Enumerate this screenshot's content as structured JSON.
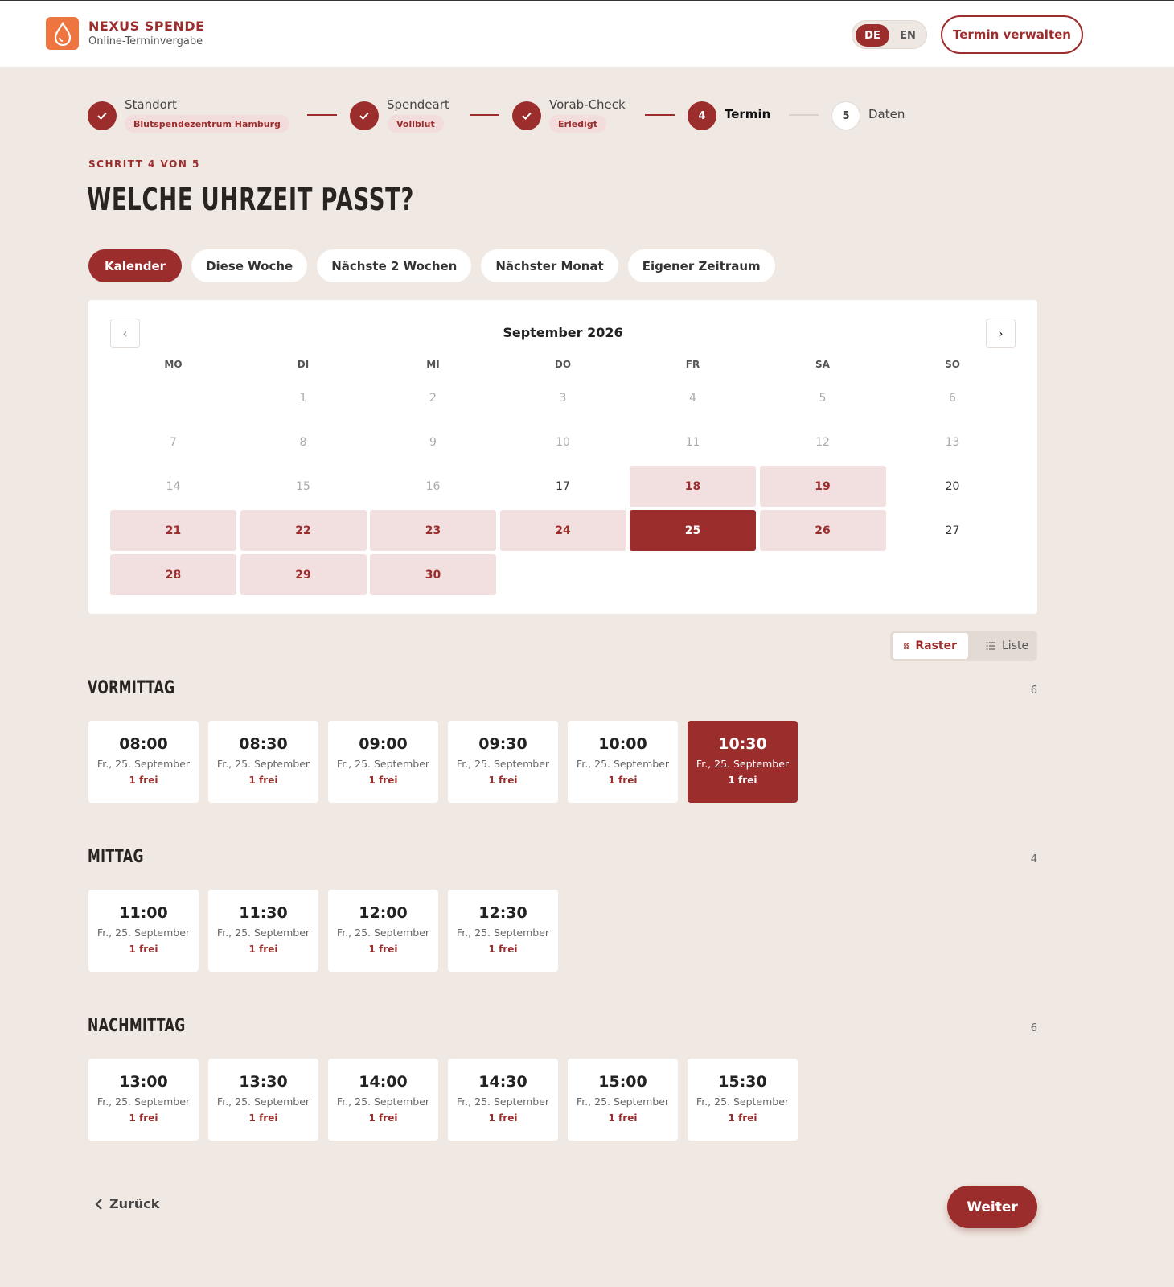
{
  "header": {
    "brand_name": "NEXUS SPENDE",
    "brand_sub": "Online-Terminvergabe",
    "lang_de": "DE",
    "lang_en": "EN",
    "active_lang": "DE",
    "manage_label": "Termin verwalten",
    "logo_icon": "blood-drop-icon"
  },
  "steps": [
    {
      "label": "Standort",
      "chip": "Blutspendezentrum Hamburg",
      "status": "done"
    },
    {
      "label": "Spendeart",
      "chip": "Vollblut",
      "status": "done"
    },
    {
      "label": "Vorab-Check",
      "chip": "Erledigt",
      "status": "done"
    },
    {
      "label": "Termin",
      "number": "4",
      "status": "current"
    },
    {
      "label": "Daten",
      "number": "5",
      "status": "todo"
    }
  ],
  "step_of": "SCHRITT 4 VON 5",
  "title": "WELCHE UHRZEIT PASST?",
  "range_tabs": [
    "Kalender",
    "Diese Woche",
    "Nächste 2 Wochen",
    "Nächster Monat",
    "Eigener Zeitraum"
  ],
  "active_range_tab": "Kalender",
  "calendar": {
    "month_label": "September 2026",
    "weekdays": [
      "MO",
      "DI",
      "MI",
      "DO",
      "FR",
      "SA",
      "SO"
    ],
    "days": [
      {
        "d": "",
        "s": "empty"
      },
      {
        "d": "1",
        "s": "past"
      },
      {
        "d": "2",
        "s": "past"
      },
      {
        "d": "3",
        "s": "past"
      },
      {
        "d": "4",
        "s": "past"
      },
      {
        "d": "5",
        "s": "past"
      },
      {
        "d": "6",
        "s": "past"
      },
      {
        "d": "7",
        "s": "past"
      },
      {
        "d": "8",
        "s": "past"
      },
      {
        "d": "9",
        "s": "past"
      },
      {
        "d": "10",
        "s": "past"
      },
      {
        "d": "11",
        "s": "past"
      },
      {
        "d": "12",
        "s": "past"
      },
      {
        "d": "13",
        "s": "past"
      },
      {
        "d": "14",
        "s": "past"
      },
      {
        "d": "15",
        "s": "past"
      },
      {
        "d": "16",
        "s": "past"
      },
      {
        "d": "17",
        "s": "open"
      },
      {
        "d": "18",
        "s": "avail"
      },
      {
        "d": "19",
        "s": "avail"
      },
      {
        "d": "20",
        "s": "open"
      },
      {
        "d": "21",
        "s": "avail"
      },
      {
        "d": "22",
        "s": "avail"
      },
      {
        "d": "23",
        "s": "avail"
      },
      {
        "d": "24",
        "s": "avail"
      },
      {
        "d": "25",
        "s": "selected"
      },
      {
        "d": "26",
        "s": "avail"
      },
      {
        "d": "27",
        "s": "open"
      },
      {
        "d": "28",
        "s": "avail"
      },
      {
        "d": "29",
        "s": "avail"
      },
      {
        "d": "30",
        "s": "avail"
      }
    ]
  },
  "view_toggle": {
    "grid_label": "Raster",
    "list_label": "Liste",
    "active": "Raster"
  },
  "sections": [
    {
      "title": "VORMITTAG",
      "count": "6",
      "slots": [
        {
          "time": "08:00",
          "date": "Fr., 25. September",
          "free": "1 frei"
        },
        {
          "time": "08:30",
          "date": "Fr., 25. September",
          "free": "1 frei"
        },
        {
          "time": "09:00",
          "date": "Fr., 25. September",
          "free": "1 frei"
        },
        {
          "time": "09:30",
          "date": "Fr., 25. September",
          "free": "1 frei"
        },
        {
          "time": "10:00",
          "date": "Fr., 25. September",
          "free": "1 frei"
        },
        {
          "time": "10:30",
          "date": "Fr., 25. September",
          "free": "1 frei",
          "selected": true
        }
      ]
    },
    {
      "title": "MITTAG",
      "count": "4",
      "slots": [
        {
          "time": "11:00",
          "date": "Fr., 25. September",
          "free": "1 frei"
        },
        {
          "time": "11:30",
          "date": "Fr., 25. September",
          "free": "1 frei"
        },
        {
          "time": "12:00",
          "date": "Fr., 25. September",
          "free": "1 frei"
        },
        {
          "time": "12:30",
          "date": "Fr., 25. September",
          "free": "1 frei"
        }
      ]
    },
    {
      "title": "NACHMITTAG",
      "count": "6",
      "slots": [
        {
          "time": "13:00",
          "date": "Fr., 25. September",
          "free": "1 frei"
        },
        {
          "time": "13:30",
          "date": "Fr., 25. September",
          "free": "1 frei"
        },
        {
          "time": "14:00",
          "date": "Fr., 25. September",
          "free": "1 frei"
        },
        {
          "time": "14:30",
          "date": "Fr., 25. September",
          "free": "1 frei"
        },
        {
          "time": "15:00",
          "date": "Fr., 25. September",
          "free": "1 frei"
        },
        {
          "time": "15:30",
          "date": "Fr., 25. September",
          "free": "1 frei"
        }
      ]
    }
  ],
  "footer": {
    "back_label": "Zurück",
    "next_label": "Weiter"
  },
  "colors": {
    "accent": "#9c2d2d",
    "background": "#f0e8e2",
    "available_day": "#f2e0e0",
    "logo": "#ee7540"
  }
}
